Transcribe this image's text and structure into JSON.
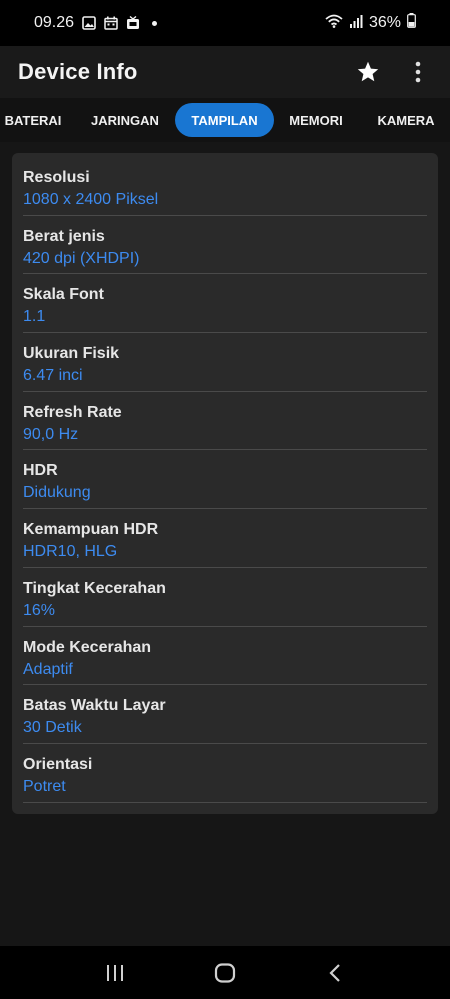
{
  "status_bar": {
    "time": "09.26",
    "battery": "36%"
  },
  "app_bar": {
    "title": "Device Info"
  },
  "tabs": [
    {
      "label": "BATERAI",
      "active": false
    },
    {
      "label": "JARINGAN",
      "active": false
    },
    {
      "label": "TAMPILAN",
      "active": true
    },
    {
      "label": "MEMORI",
      "active": false
    },
    {
      "label": "KAMERA",
      "active": false
    }
  ],
  "display_info": [
    {
      "label": "Resolusi",
      "value": "1080 x 2400 Piksel"
    },
    {
      "label": "Berat jenis",
      "value": "420 dpi (XHDPI)"
    },
    {
      "label": "Skala Font",
      "value": "1.1"
    },
    {
      "label": "Ukuran Fisik",
      "value": "6.47 inci"
    },
    {
      "label": "Refresh Rate",
      "value": "90,0 Hz"
    },
    {
      "label": "HDR",
      "value": "Didukung"
    },
    {
      "label": "Kemampuan HDR",
      "value": "HDR10, HLG"
    },
    {
      "label": "Tingkat Kecerahan",
      "value": "16%"
    },
    {
      "label": "Mode Kecerahan",
      "value": "Adaptif"
    },
    {
      "label": "Batas Waktu Layar",
      "value": "30 Detik"
    },
    {
      "label": "Orientasi",
      "value": "Potret"
    }
  ],
  "colors": {
    "accent": "#1976d2",
    "value_text": "#3d8bf0",
    "card_bg": "#2a2a2a",
    "page_bg": "#161616"
  },
  "icons": {
    "favorite": "star-icon",
    "menu": "more-vert-icon",
    "nav_recents": "recents-icon",
    "nav_home": "home-icon",
    "nav_back": "back-icon"
  }
}
